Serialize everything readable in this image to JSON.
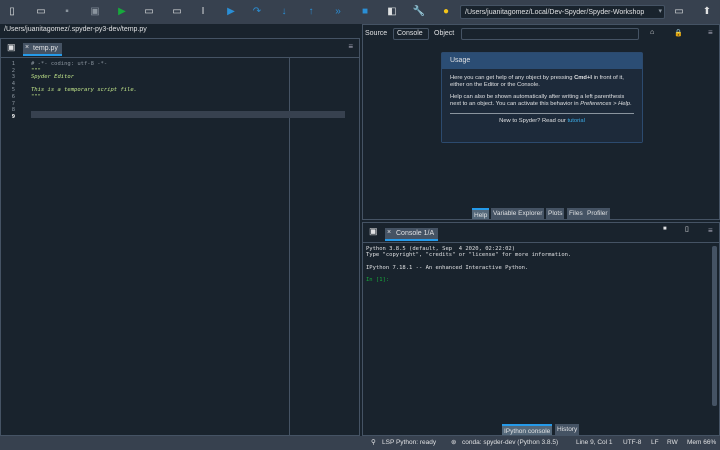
{
  "toolbar": {
    "icons": [
      "new-file",
      "open-file",
      "save-file",
      "save-all",
      "run",
      "run-cell",
      "run-cell-advance",
      "run-selection",
      "debug",
      "step",
      "step-into",
      "step-return",
      "continue",
      "stop",
      "maximize-pane",
      "preferences",
      "python-path-manager"
    ],
    "cwd": "/Users/juanitagomez/Local/Dev-Spyder/Spyder-Workshop"
  },
  "editor": {
    "path": "/Users/juanitagomez/.spyder-py3-dev/temp.py",
    "tab": "temp.py",
    "current_line": "9",
    "lines": [
      {
        "n": "1",
        "text": "# -*- coding: utf-8 -*-",
        "cls": "comment"
      },
      {
        "n": "2",
        "text": "\"\"\"",
        "cls": "doc"
      },
      {
        "n": "3",
        "text": "Spyder Editor",
        "cls": "doc"
      },
      {
        "n": "4",
        "text": "",
        "cls": "doc"
      },
      {
        "n": "5",
        "text": "This is a temporary script file.",
        "cls": "doc"
      },
      {
        "n": "6",
        "text": "\"\"\"",
        "cls": "doc"
      },
      {
        "n": "7",
        "text": "",
        "cls": ""
      },
      {
        "n": "8",
        "text": "",
        "cls": ""
      }
    ]
  },
  "help": {
    "source_label": "Source",
    "source_value": "Console",
    "object_label": "Object",
    "object_value": "",
    "usage": {
      "title": "Usage",
      "p1_a": "Here you can get help of any object by pressing ",
      "p1_key": "Cmd+I",
      "p1_b": " in front of it, either on the Editor or the Console.",
      "p2_a": "Help can also be shown automatically after writing a left parenthesis next to an object. You can activate this behavior in ",
      "p2_link": "Preferences > Help",
      "p2_b": ".",
      "footer": "New to Spyder? Read our ",
      "footer_link": "tutorial"
    },
    "tabs": [
      "Help",
      "Variable Explorer",
      "Plots",
      "Files",
      "Profiler"
    ]
  },
  "console": {
    "tab": "Console 1/A",
    "lines": [
      "Python 3.8.5 (default, Sep  4 2020, 02:22:02)",
      "Type \"copyright\", \"credits\" or \"license\" for more information.",
      "",
      "IPython 7.18.1 -- An enhanced Interactive Python.",
      ""
    ],
    "prompt": "In [1]:",
    "tabs": [
      "IPython console",
      "History"
    ]
  },
  "status": {
    "lsp": "LSP Python: ready",
    "conda": "conda: spyder-dev (Python 3.8.5)",
    "position": "Line 9, Col 1",
    "encoding": "UTF-8",
    "eol": "LF",
    "rw": "RW",
    "mem": "Mem 66%"
  },
  "colors": {
    "accent": "#259ae9",
    "background": "#19232d",
    "toolbar": "#37414f",
    "docstring": "#c1e58a",
    "prompt": "#17a93c",
    "link": "#3daee9"
  }
}
